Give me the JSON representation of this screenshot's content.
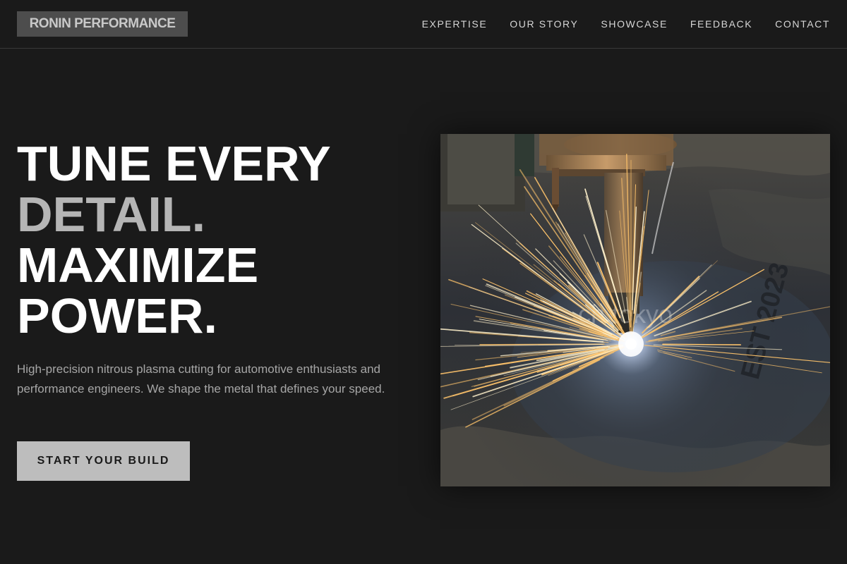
{
  "nav": {
    "logo": "RONIN PERFORMANCE",
    "links": [
      "EXPERTISE",
      "OUR STORY",
      "SHOWCASE",
      "FEEDBACK",
      "CONTACT"
    ]
  },
  "hero": {
    "title_lines": [
      "TUNE EVERY",
      "DETAIL.",
      "MAXIMIZE",
      "POWER."
    ],
    "description": "High-precision nitrous plasma cutting for automotive enthusiasts and performance engineers. We shape the metal that defines your speed.",
    "cta_label": "START YOUR BUILD",
    "image_watermark": "ch.tokyo",
    "image_plate_text": "EST 2023"
  },
  "colors": {
    "background": "#1a1a1a",
    "logo_bg": "#4d4d4d",
    "title_white": "#ffffff",
    "title_muted": "#b5b5b5",
    "cta_bg": "#bdbdbd",
    "spark": "#ffc46b"
  },
  "icons": {
    "hero_image": "plasma-cutting-photo"
  }
}
